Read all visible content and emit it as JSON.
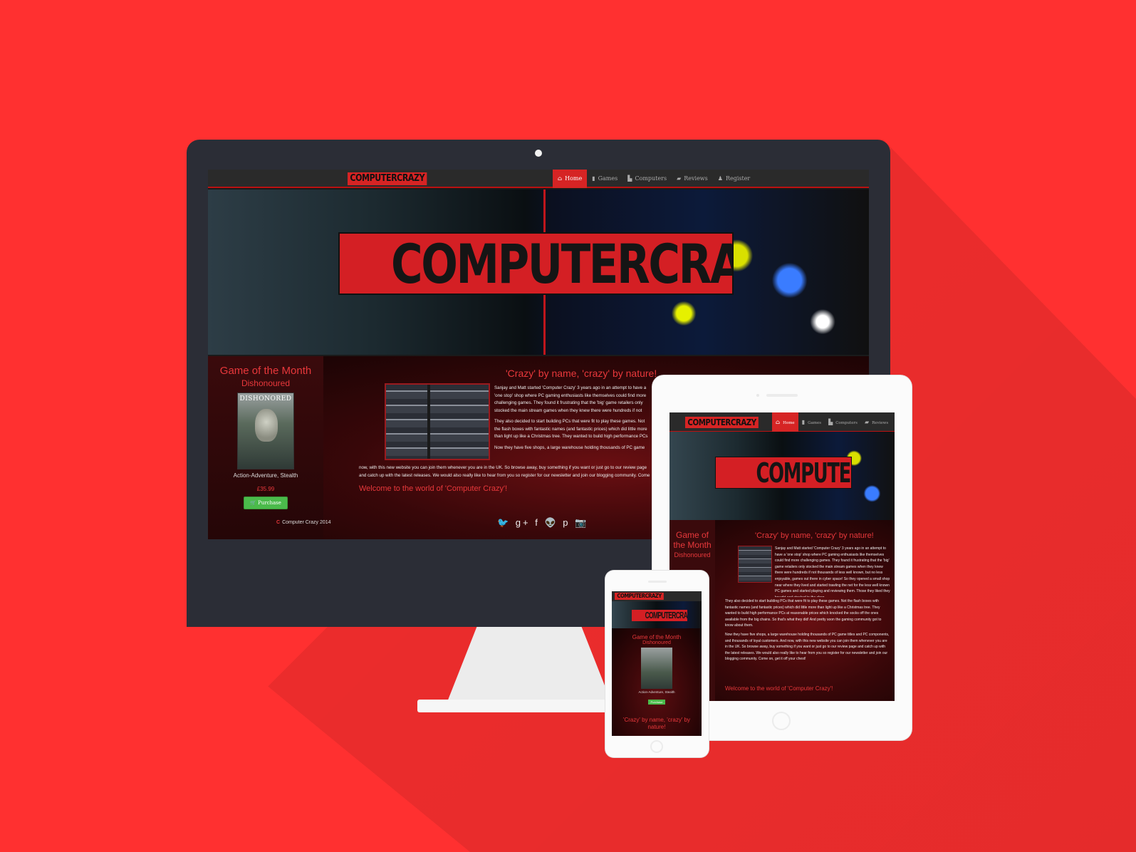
{
  "brand": {
    "name": "COMPUTERCRAZY",
    "accent": "#d62424",
    "background": "#ff3030",
    "button_green": "#4bbb4b"
  },
  "nav": {
    "items": [
      {
        "label": "Home",
        "icon": "home-icon"
      },
      {
        "label": "Games",
        "icon": "bookmark-icon"
      },
      {
        "label": "Computers",
        "icon": "computer-icon"
      },
      {
        "label": "Reviews",
        "icon": "comment-icon"
      },
      {
        "label": "Register",
        "icon": "user-icon"
      }
    ]
  },
  "hero": {
    "logo_text": "COMPUTERCRAZY"
  },
  "game_of_month": {
    "heading": "Game of the Month",
    "heading_line1": "Game of",
    "heading_line2": "the Month",
    "game": "Dishonoured",
    "cover_title": "DISHONORED",
    "genre": "Action-Adventure, Stealth",
    "price": "£35.99",
    "purchase_label": "Purchase"
  },
  "about": {
    "title": "'Crazy' by name, 'crazy' by nature!",
    "paragraphs": [
      "Sanjay and Matt started 'Computer Crazy' 3 years ago in an attempt to have a 'one stop' shop where PC gaming enthusiasts like themselves could find more challenging games. They found it frustrating that the 'big' game retailers only stocked the main stream games when they knew there were hundreds if not thousands of less well known, but no less enjoyable, games out there in cyber space! So they opened a small shop near where they lived and started trawling the net for the less well known PC games and started playing and reviewing them. Those they liked they bought and stocked in the shop.",
      "They also decided to start building PCs that were fit to play these games. Not the flash boxes with fantastic names (and fantastic prices) which did little more than light up like a Christmas tree. They wanted to build high performance PCs at reasonable prices which knocked the socks off the ones available from the big chains. So that's what they did! And pretty soon the gaming community got to know about them.",
      "Now they have five shops, a large warehouse holding thousands of PC game titles and PC components, and thousands of loyal customers. And now, with this new website you can join them whenever you are in the UK. So browse away, buy something if you want or just go to our review page and catch up with the latest releases. We would also really like to hear from you so register for our newsletter and join our blogging community. Come on, get it off your chest!"
    ],
    "wide_text": "now, with this new website you can join them whenever you are in the UK. So browse away, buy something if you want or just go to our review page and catch up with the latest releases. We would also really like to hear from you so register for our newsletter and join our blogging community. Come on, get it off your chest!",
    "welcome": "Welcome to the world of 'Computer Crazy'!"
  },
  "social": {
    "icons": "🐦 g+ f 👽 p 📷"
  },
  "footer": {
    "copyright": "Computer Crazy 2014"
  }
}
